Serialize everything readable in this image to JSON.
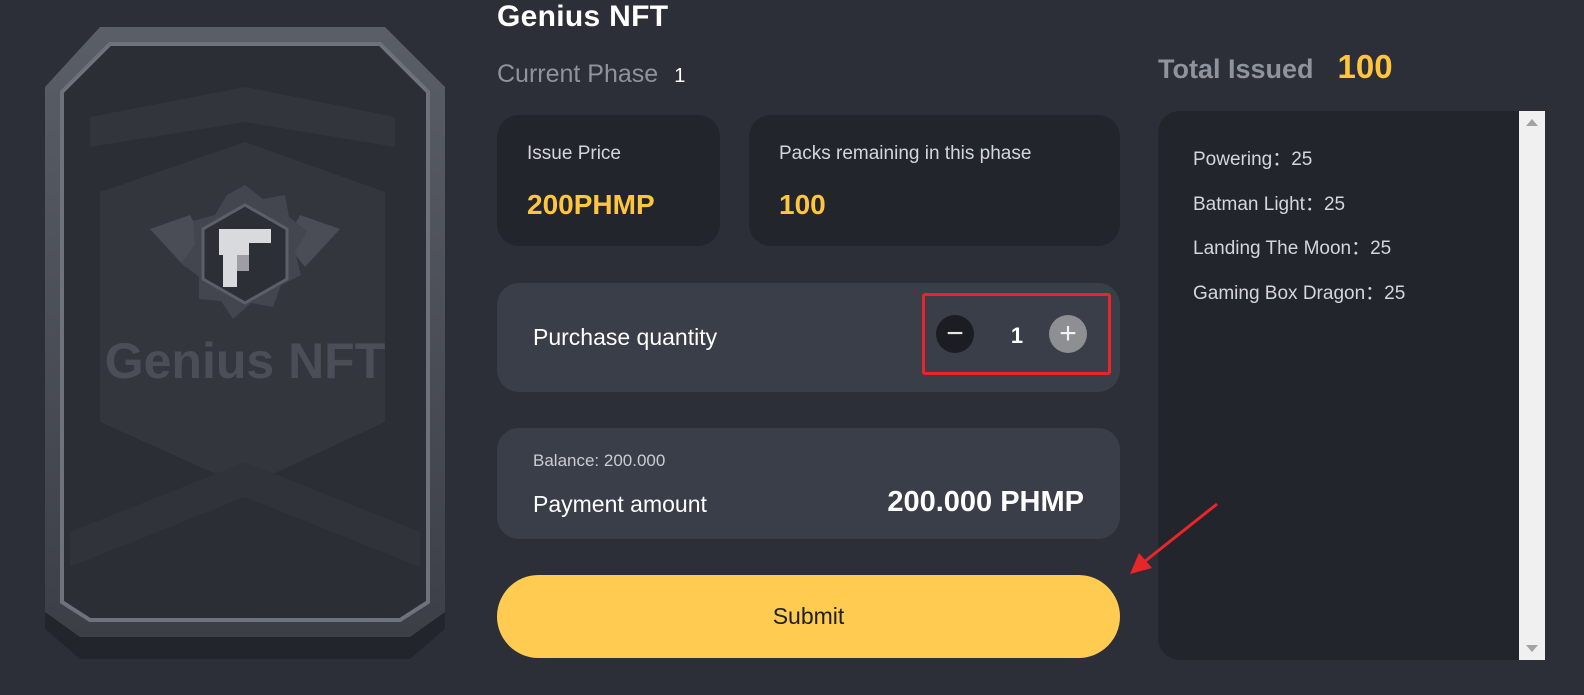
{
  "card": {
    "logo_text": "Genius NFT"
  },
  "header": {
    "title": "Genius NFT",
    "phase_label": "Current Phase",
    "phase_value": "1"
  },
  "issue_price": {
    "label": "Issue Price",
    "value": "200PHMP"
  },
  "packs_remaining": {
    "label": "Packs remaining in this phase",
    "value": "100"
  },
  "purchase": {
    "label": "Purchase quantity",
    "quantity": "1",
    "minus_icon": "−",
    "plus_icon": "+"
  },
  "payment": {
    "balance": "Balance: 200.000",
    "label": "Payment amount",
    "amount": "200.000 PHMP"
  },
  "submit_label": "Submit",
  "total": {
    "label": "Total Issued",
    "value": "100"
  },
  "distribution": [
    "Powering：25",
    "Batman Light：25",
    "Landing The Moon：25",
    "Gaming Box Dragon：25"
  ],
  "colors": {
    "background": "#2c2f37",
    "accent": "#ffc53d",
    "button": "#ffcb50",
    "highlight_box": "#e8262a"
  }
}
